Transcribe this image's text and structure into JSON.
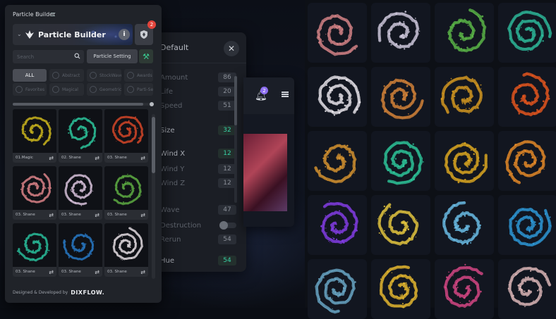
{
  "panel": {
    "title": "Particle Builder",
    "header_name": "Particle Builder",
    "info_label": "i",
    "notification_count": "2",
    "search_placeholder": "Search",
    "setting_button": "Particle Setting",
    "categories": [
      {
        "label": "ALL",
        "icon": "none"
      },
      {
        "label": "Abstract",
        "icon": "abstract-icon"
      },
      {
        "label": "StockWave",
        "icon": "wave-icon"
      },
      {
        "label": "Awards",
        "icon": "laurel-icon"
      },
      {
        "label": "Favorites",
        "icon": "star-icon"
      },
      {
        "label": "Magical",
        "icon": "magic-icon"
      },
      {
        "label": "Geometric",
        "icon": "cube-icon"
      },
      {
        "label": "Parti-Sea",
        "icon": "grid-icon"
      }
    ],
    "cards": [
      {
        "label": "01.Magic",
        "color": "#d9c21e"
      },
      {
        "label": "02. Shane",
        "color": "#2fd2a6"
      },
      {
        "label": "03. Shane",
        "color": "#e04a2a"
      },
      {
        "label": "03. Shane",
        "color": "#e88a8f"
      },
      {
        "label": "03. Shane",
        "color": "#e6cde8"
      },
      {
        "label": "03. Shane",
        "color": "#63b646"
      },
      {
        "label": "03. Shane",
        "color": "#2bc8a3"
      },
      {
        "label": "03. Shane",
        "color": "#2a7fd0"
      },
      {
        "label": "03. Shane",
        "color": "#f0e8ee"
      }
    ],
    "credit": "Designed & Developed by",
    "brand": "DIXFLOW."
  },
  "settings": {
    "title": "Default",
    "rows": [
      {
        "label": "Amount",
        "value": "86",
        "hi": false,
        "strong": false
      },
      {
        "label": "Life",
        "value": "20",
        "hi": false,
        "strong": false
      },
      {
        "label": "Speed",
        "value": "51",
        "hi": false,
        "strong": false
      },
      {
        "label": "Size",
        "value": "32",
        "hi": true,
        "strong": true
      },
      {
        "label": "Wind X",
        "value": "12",
        "hi": true,
        "strong": true
      },
      {
        "label": "Wind Y",
        "value": "12",
        "hi": false,
        "strong": false
      },
      {
        "label": "Wind Z",
        "value": "12",
        "hi": false,
        "strong": false
      },
      {
        "label": "Wave",
        "value": "47",
        "hi": false,
        "strong": false
      },
      {
        "label": "Destruction",
        "value": "",
        "hi": false,
        "strong": false
      },
      {
        "label": "Rerun",
        "value": "54",
        "hi": false,
        "strong": false
      },
      {
        "label": "Hue",
        "value": "54",
        "hi": true,
        "strong": true
      }
    ]
  },
  "preview": {
    "notification_count": "2"
  },
  "gallery": {
    "tiles": [
      "#e08a8c",
      "#d8d2e6",
      "#5fbf4a",
      "#2fc2a0",
      "#f4f0f5",
      "#e08a3a",
      "#e0a020",
      "#f05a1e",
      "#e09a30",
      "#2fcfa0",
      "#e8b020",
      "#f09028",
      "#8a3ff0",
      "#f0d040",
      "#6fc6f0",
      "#2f9fe0",
      "#6fb0d0",
      "#f0c030",
      "#e04a8a",
      "#e8c0c0"
    ]
  }
}
